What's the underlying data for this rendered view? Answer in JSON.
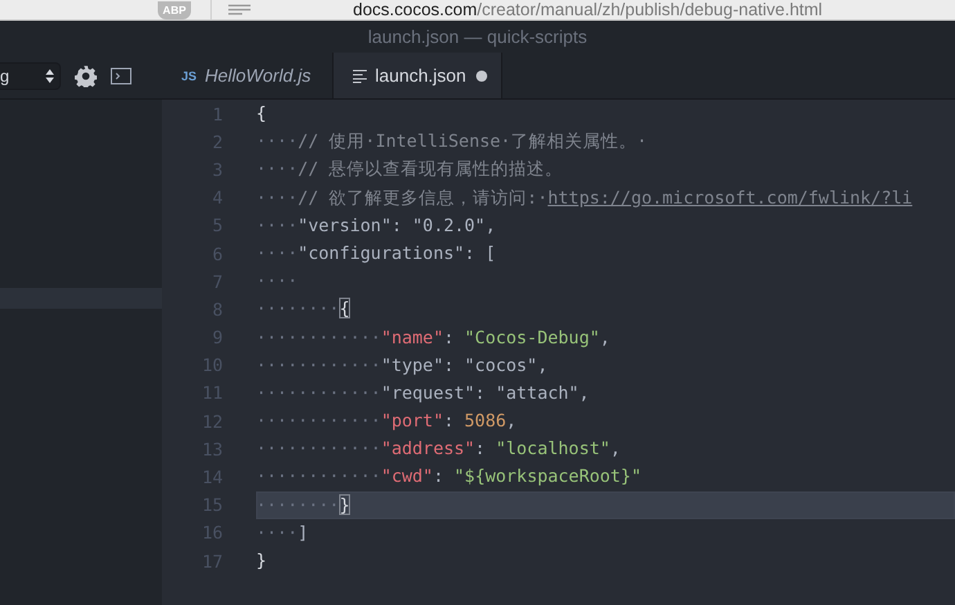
{
  "browser": {
    "url_host": "docs.cocos.com",
    "url_path": "/creator/manual/zh/publish/debug-native.html",
    "adblock_label": "ABP"
  },
  "window": {
    "title": "launch.json — quick-scripts"
  },
  "toolbar": {
    "select_value": "g"
  },
  "tabs": [
    {
      "label": "HelloWorld.js",
      "kind": "js",
      "icon_text": "JS",
      "selected": false,
      "modified": false
    },
    {
      "label": "launch.json",
      "kind": "text",
      "selected": true,
      "modified": true
    }
  ],
  "editor": {
    "lines": [
      {
        "number": "1",
        "current": false,
        "tokens": [
          {
            "kind": "punct",
            "text": "{"
          }
        ]
      },
      {
        "number": "2",
        "current": false,
        "tokens": [
          {
            "kind": "ws",
            "text": "····"
          },
          {
            "kind": "comment",
            "text": "// 使用·IntelliSense·了解相关属性。·"
          }
        ]
      },
      {
        "number": "3",
        "current": false,
        "tokens": [
          {
            "kind": "ws",
            "text": "····"
          },
          {
            "kind": "comment",
            "text": "// 悬停以查看现有属性的描述。"
          }
        ]
      },
      {
        "number": "4",
        "current": false,
        "tokens": [
          {
            "kind": "ws",
            "text": "····"
          },
          {
            "kind": "comment",
            "text": "// 欲了解更多信息，请访问:·"
          },
          {
            "kind": "link",
            "text": "https://go.microsoft.com/fwlink/?li"
          }
        ]
      },
      {
        "number": "5",
        "current": false,
        "tokens": [
          {
            "kind": "ws",
            "text": "····"
          },
          {
            "kind": "text",
            "text": "\"version\": \"0.2.0\","
          }
        ]
      },
      {
        "number": "6",
        "current": false,
        "tokens": [
          {
            "kind": "ws",
            "text": "····"
          },
          {
            "kind": "text",
            "text": "\"configurations\": ["
          }
        ]
      },
      {
        "number": "7",
        "current": false,
        "tokens": [
          {
            "kind": "ws",
            "text": "····"
          }
        ]
      },
      {
        "number": "8",
        "current": false,
        "tokens": [
          {
            "kind": "ws",
            "text": "········"
          },
          {
            "kind": "match",
            "text": "{"
          }
        ]
      },
      {
        "number": "9",
        "current": false,
        "tokens": [
          {
            "kind": "ws",
            "text": "············"
          },
          {
            "kind": "key",
            "text": "\"name\""
          },
          {
            "kind": "text",
            "text": ": "
          },
          {
            "kind": "string",
            "text": "\"Cocos-Debug\""
          },
          {
            "kind": "text",
            "text": ","
          }
        ]
      },
      {
        "number": "10",
        "current": false,
        "tokens": [
          {
            "kind": "ws",
            "text": "············"
          },
          {
            "kind": "text",
            "text": "\"type\": \"cocos\","
          }
        ]
      },
      {
        "number": "11",
        "current": false,
        "tokens": [
          {
            "kind": "ws",
            "text": "············"
          },
          {
            "kind": "text",
            "text": "\"request\": \"attach\","
          }
        ]
      },
      {
        "number": "12",
        "current": false,
        "tokens": [
          {
            "kind": "ws",
            "text": "············"
          },
          {
            "kind": "key",
            "text": "\"port\""
          },
          {
            "kind": "text",
            "text": ": "
          },
          {
            "kind": "number",
            "text": "5086"
          },
          {
            "kind": "text",
            "text": ","
          }
        ]
      },
      {
        "number": "13",
        "current": false,
        "tokens": [
          {
            "kind": "ws",
            "text": "············"
          },
          {
            "kind": "key",
            "text": "\"address\""
          },
          {
            "kind": "text",
            "text": ": "
          },
          {
            "kind": "string",
            "text": "\"localhost\""
          },
          {
            "kind": "text",
            "text": ","
          }
        ]
      },
      {
        "number": "14",
        "current": false,
        "tokens": [
          {
            "kind": "ws",
            "text": "············"
          },
          {
            "kind": "key",
            "text": "\"cwd\""
          },
          {
            "kind": "text",
            "text": ": "
          },
          {
            "kind": "string",
            "text": "\"${workspaceRoot}\""
          }
        ]
      },
      {
        "number": "15",
        "current": true,
        "tokens": [
          {
            "kind": "ws",
            "text": "········"
          },
          {
            "kind": "match",
            "text": "}"
          }
        ]
      },
      {
        "number": "16",
        "current": false,
        "tokens": [
          {
            "kind": "ws",
            "text": "····"
          },
          {
            "kind": "text",
            "text": "]"
          }
        ]
      },
      {
        "number": "17",
        "current": false,
        "tokens": [
          {
            "kind": "punct",
            "text": "}"
          }
        ]
      }
    ]
  }
}
